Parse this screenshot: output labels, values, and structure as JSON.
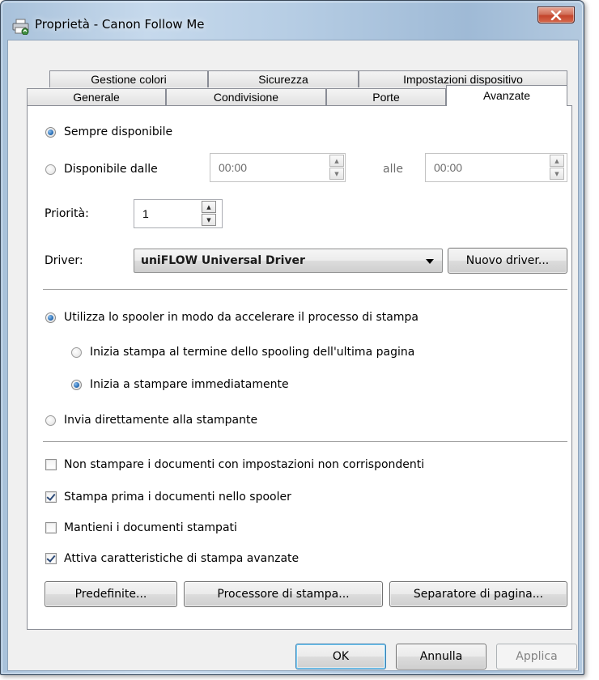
{
  "window": {
    "title": "Proprietà - Canon Follow Me",
    "close_label": "X"
  },
  "tabs": {
    "row1": [
      "Gestione colori",
      "Sicurezza",
      "Impostazioni dispositivo"
    ],
    "row2": [
      "Generale",
      "Condivisione",
      "Porte",
      "Avanzate"
    ],
    "active": "Avanzate"
  },
  "availability": {
    "always_label": "Sempre disponibile",
    "always_selected": true,
    "from_label": "Disponibile dalle",
    "from_selected": false,
    "start_time": "00:00",
    "to_label": "alle",
    "end_time": "00:00"
  },
  "priority": {
    "label": "Priorità:",
    "value": "1"
  },
  "driver": {
    "label": "Driver:",
    "selected": "uniFLOW Universal Driver",
    "new_driver_button": "Nuovo driver..."
  },
  "spooling": {
    "use_spooler_label": "Utilizza lo spooler in modo da accelerare il processo di stampa",
    "use_spooler_selected": true,
    "after_last_page_label": "Inizia stampa al termine dello spooling dell'ultima pagina",
    "after_last_page_selected": false,
    "immediately_label": "Inizia a stampare immediatamente",
    "immediately_selected": true,
    "direct_label": "Invia direttamente alla stampante",
    "direct_selected": false
  },
  "options": [
    {
      "label": "Non stampare i documenti con impostazioni non corrispondenti",
      "checked": false
    },
    {
      "label": "Stampa prima i documenti nello spooler",
      "checked": true
    },
    {
      "label": "Mantieni i documenti stampati",
      "checked": false
    },
    {
      "label": "Attiva caratteristiche di stampa avanzate",
      "checked": true
    }
  ],
  "panel_buttons": {
    "defaults": "Predefinite...",
    "print_processor": "Processore di stampa...",
    "separator_page": "Separatore di pagina..."
  },
  "dialog_buttons": {
    "ok": "OK",
    "cancel": "Annulla",
    "apply": "Applica"
  }
}
